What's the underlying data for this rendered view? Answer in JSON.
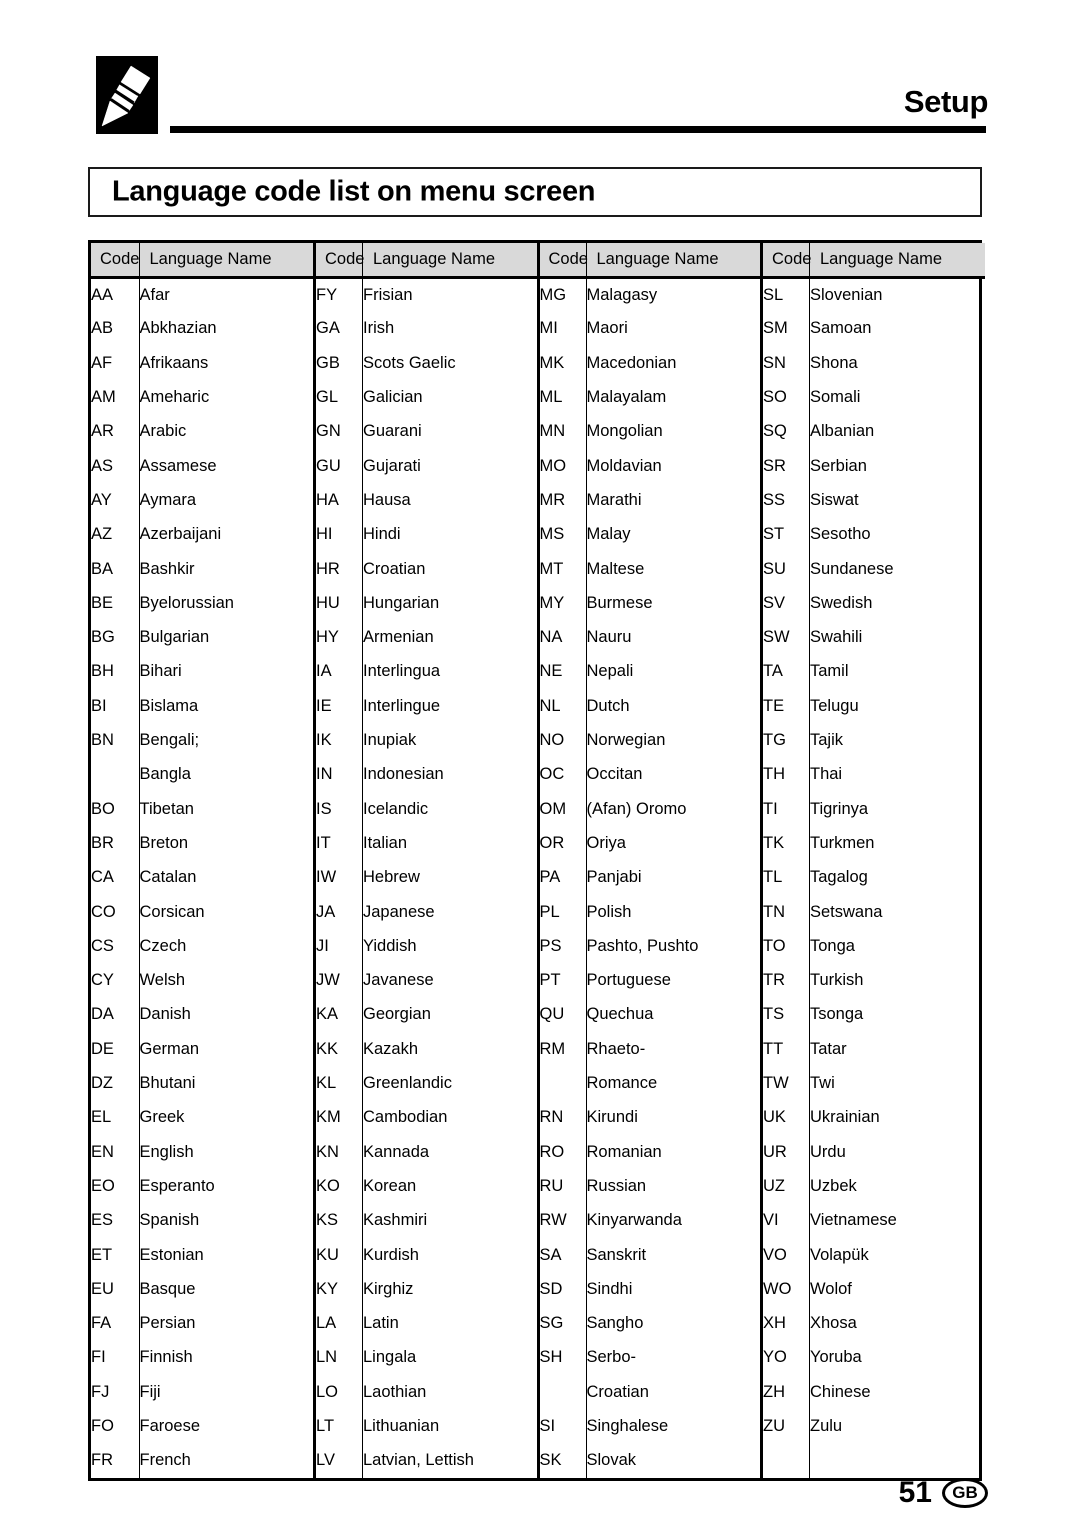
{
  "header": {
    "icon": "marker-pen-icon",
    "section_title": "Setup"
  },
  "title": {
    "heading": "Language code list on menu screen"
  },
  "table": {
    "columns_per_group": [
      "Code",
      "Language Name"
    ],
    "headers": [
      {
        "code": "Code",
        "name": "Language Name"
      },
      {
        "code": "Code",
        "name": "Language Name"
      },
      {
        "code": "Code",
        "name": "Language Name"
      },
      {
        "code": "Code",
        "name": "Language Name"
      }
    ],
    "rows": [
      [
        {
          "code": "AA",
          "name": "Afar"
        },
        {
          "code": "FY",
          "name": "Frisian"
        },
        {
          "code": "MG",
          "name": "Malagasy"
        },
        {
          "code": "SL",
          "name": "Slovenian"
        }
      ],
      [
        {
          "code": "AB",
          "name": "Abkhazian"
        },
        {
          "code": "GA",
          "name": "Irish"
        },
        {
          "code": "MI",
          "name": "Maori"
        },
        {
          "code": "SM",
          "name": "Samoan"
        }
      ],
      [
        {
          "code": "AF",
          "name": "Afrikaans"
        },
        {
          "code": "GB",
          "name": "Scots Gaelic"
        },
        {
          "code": "MK",
          "name": "Macedonian"
        },
        {
          "code": "SN",
          "name": "Shona"
        }
      ],
      [
        {
          "code": "AM",
          "name": "Ameharic"
        },
        {
          "code": "GL",
          "name": "Galician"
        },
        {
          "code": "ML",
          "name": "Malayalam"
        },
        {
          "code": "SO",
          "name": "Somali"
        }
      ],
      [
        {
          "code": "AR",
          "name": "Arabic"
        },
        {
          "code": "GN",
          "name": "Guarani"
        },
        {
          "code": "MN",
          "name": "Mongolian"
        },
        {
          "code": "SQ",
          "name": "Albanian"
        }
      ],
      [
        {
          "code": "AS",
          "name": "Assamese"
        },
        {
          "code": "GU",
          "name": "Gujarati"
        },
        {
          "code": "MO",
          "name": "Moldavian"
        },
        {
          "code": "SR",
          "name": "Serbian"
        }
      ],
      [
        {
          "code": "AY",
          "name": "Aymara"
        },
        {
          "code": "HA",
          "name": "Hausa"
        },
        {
          "code": "MR",
          "name": "Marathi"
        },
        {
          "code": "SS",
          "name": "Siswat"
        }
      ],
      [
        {
          "code": "AZ",
          "name": "Azerbaijani"
        },
        {
          "code": "HI",
          "name": "Hindi"
        },
        {
          "code": "MS",
          "name": "Malay"
        },
        {
          "code": "ST",
          "name": "Sesotho"
        }
      ],
      [
        {
          "code": "BA",
          "name": "Bashkir"
        },
        {
          "code": "HR",
          "name": "Croatian"
        },
        {
          "code": "MT",
          "name": "Maltese"
        },
        {
          "code": "SU",
          "name": "Sundanese"
        }
      ],
      [
        {
          "code": "BE",
          "name": "Byelorussian"
        },
        {
          "code": "HU",
          "name": "Hungarian"
        },
        {
          "code": "MY",
          "name": "Burmese"
        },
        {
          "code": "SV",
          "name": "Swedish"
        }
      ],
      [
        {
          "code": "BG",
          "name": "Bulgarian"
        },
        {
          "code": "HY",
          "name": "Armenian"
        },
        {
          "code": "NA",
          "name": "Nauru"
        },
        {
          "code": "SW",
          "name": "Swahili"
        }
      ],
      [
        {
          "code": "BH",
          "name": "Bihari"
        },
        {
          "code": "IA",
          "name": "Interlingua"
        },
        {
          "code": "NE",
          "name": "Nepali"
        },
        {
          "code": "TA",
          "name": "Tamil"
        }
      ],
      [
        {
          "code": "BI",
          "name": "Bislama"
        },
        {
          "code": "IE",
          "name": "Interlingue"
        },
        {
          "code": "NL",
          "name": "Dutch"
        },
        {
          "code": "TE",
          "name": "Telugu"
        }
      ],
      [
        {
          "code": "BN",
          "name": "Bengali;"
        },
        {
          "code": "IK",
          "name": "Inupiak"
        },
        {
          "code": "NO",
          "name": "Norwegian"
        },
        {
          "code": "TG",
          "name": "Tajik"
        }
      ],
      [
        {
          "code": "",
          "name": "Bangla"
        },
        {
          "code": "IN",
          "name": "Indonesian"
        },
        {
          "code": "OC",
          "name": "Occitan"
        },
        {
          "code": "TH",
          "name": "Thai"
        }
      ],
      [
        {
          "code": "BO",
          "name": "Tibetan"
        },
        {
          "code": "IS",
          "name": "Icelandic"
        },
        {
          "code": "OM",
          "name": "(Afan) Oromo"
        },
        {
          "code": "TI",
          "name": "Tigrinya"
        }
      ],
      [
        {
          "code": "BR",
          "name": "Breton"
        },
        {
          "code": "IT",
          "name": "Italian"
        },
        {
          "code": "OR",
          "name": "Oriya"
        },
        {
          "code": "TK",
          "name": "Turkmen"
        }
      ],
      [
        {
          "code": "CA",
          "name": "Catalan"
        },
        {
          "code": "IW",
          "name": "Hebrew"
        },
        {
          "code": "PA",
          "name": "Panjabi"
        },
        {
          "code": "TL",
          "name": "Tagalog"
        }
      ],
      [
        {
          "code": "CO",
          "name": "Corsican"
        },
        {
          "code": "JA",
          "name": "Japanese"
        },
        {
          "code": "PL",
          "name": "Polish"
        },
        {
          "code": "TN",
          "name": "Setswana"
        }
      ],
      [
        {
          "code": "CS",
          "name": "Czech"
        },
        {
          "code": "JI",
          "name": "Yiddish"
        },
        {
          "code": "PS",
          "name": "Pashto, Pushto"
        },
        {
          "code": "TO",
          "name": "Tonga"
        }
      ],
      [
        {
          "code": "CY",
          "name": "Welsh"
        },
        {
          "code": "JW",
          "name": "Javanese"
        },
        {
          "code": "PT",
          "name": "Portuguese"
        },
        {
          "code": "TR",
          "name": "Turkish"
        }
      ],
      [
        {
          "code": "DA",
          "name": "Danish"
        },
        {
          "code": "KA",
          "name": "Georgian"
        },
        {
          "code": "QU",
          "name": "Quechua"
        },
        {
          "code": "TS",
          "name": "Tsonga"
        }
      ],
      [
        {
          "code": "DE",
          "name": "German"
        },
        {
          "code": "KK",
          "name": "Kazakh"
        },
        {
          "code": "RM",
          "name": "Rhaeto-"
        },
        {
          "code": "TT",
          "name": "Tatar"
        }
      ],
      [
        {
          "code": "DZ",
          "name": "Bhutani"
        },
        {
          "code": "KL",
          "name": "Greenlandic"
        },
        {
          "code": "",
          "name": "Romance"
        },
        {
          "code": "TW",
          "name": "Twi"
        }
      ],
      [
        {
          "code": "EL",
          "name": "Greek"
        },
        {
          "code": "KM",
          "name": "Cambodian"
        },
        {
          "code": "RN",
          "name": "Kirundi"
        },
        {
          "code": "UK",
          "name": "Ukrainian"
        }
      ],
      [
        {
          "code": "EN",
          "name": "English"
        },
        {
          "code": "KN",
          "name": "Kannada"
        },
        {
          "code": "RO",
          "name": "Romanian"
        },
        {
          "code": "UR",
          "name": "Urdu"
        }
      ],
      [
        {
          "code": "EO",
          "name": "Esperanto"
        },
        {
          "code": "KO",
          "name": "Korean"
        },
        {
          "code": "RU",
          "name": "Russian"
        },
        {
          "code": "UZ",
          "name": "Uzbek"
        }
      ],
      [
        {
          "code": "ES",
          "name": "Spanish"
        },
        {
          "code": "KS",
          "name": "Kashmiri"
        },
        {
          "code": "RW",
          "name": "Kinyarwanda"
        },
        {
          "code": "VI",
          "name": "Vietnamese"
        }
      ],
      [
        {
          "code": "ET",
          "name": "Estonian"
        },
        {
          "code": "KU",
          "name": "Kurdish"
        },
        {
          "code": "SA",
          "name": "Sanskrit"
        },
        {
          "code": "VO",
          "name": "Volapük"
        }
      ],
      [
        {
          "code": "EU",
          "name": "Basque"
        },
        {
          "code": "KY",
          "name": "Kirghiz"
        },
        {
          "code": "SD",
          "name": "Sindhi"
        },
        {
          "code": "WO",
          "name": "Wolof"
        }
      ],
      [
        {
          "code": "FA",
          "name": "Persian"
        },
        {
          "code": "LA",
          "name": "Latin"
        },
        {
          "code": "SG",
          "name": "Sangho"
        },
        {
          "code": "XH",
          "name": "Xhosa"
        }
      ],
      [
        {
          "code": "FI",
          "name": "Finnish"
        },
        {
          "code": "LN",
          "name": "Lingala"
        },
        {
          "code": "SH",
          "name": "Serbo-"
        },
        {
          "code": "YO",
          "name": "Yoruba"
        }
      ],
      [
        {
          "code": "FJ",
          "name": "Fiji"
        },
        {
          "code": "LO",
          "name": "Laothian"
        },
        {
          "code": "",
          "name": "Croatian"
        },
        {
          "code": "ZH",
          "name": "Chinese"
        }
      ],
      [
        {
          "code": "FO",
          "name": "Faroese"
        },
        {
          "code": "LT",
          "name": "Lithuanian"
        },
        {
          "code": "SI",
          "name": "Singhalese"
        },
        {
          "code": "ZU",
          "name": "Zulu"
        }
      ],
      [
        {
          "code": "FR",
          "name": "French"
        },
        {
          "code": "LV",
          "name": "Latvian, Lettish"
        },
        {
          "code": "SK",
          "name": "Slovak"
        },
        {
          "code": "",
          "name": ""
        }
      ]
    ]
  },
  "footer": {
    "page_number": "51",
    "region_code": "GB"
  }
}
